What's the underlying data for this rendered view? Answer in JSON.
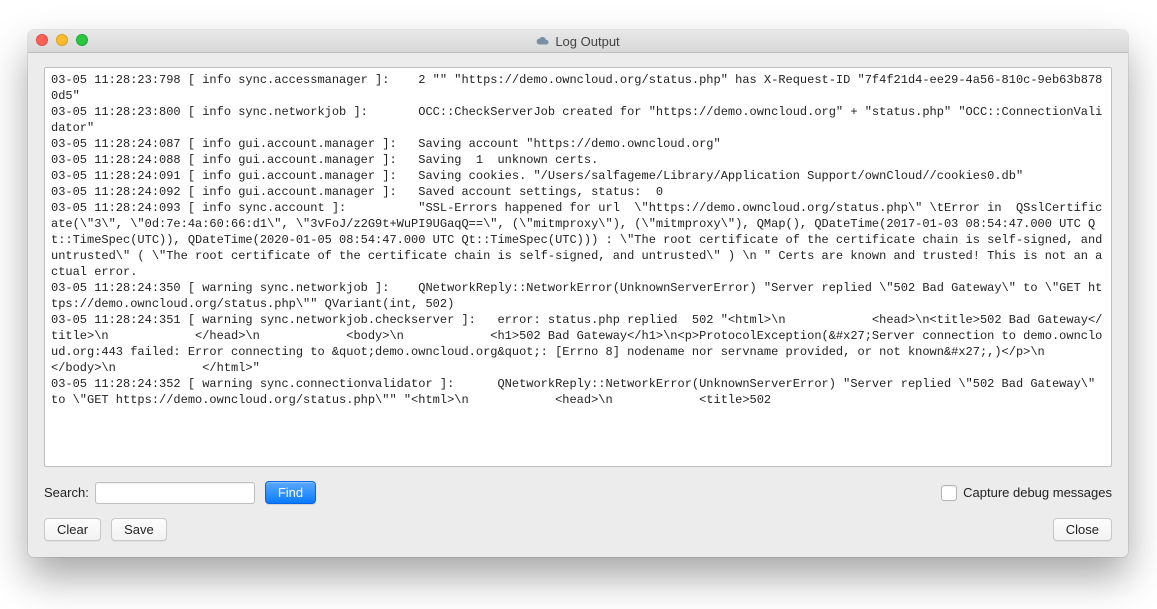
{
  "window": {
    "title": "Log Output"
  },
  "log": {
    "lines": [
      "03-05 11:28:23:798 [ info sync.accessmanager ]:    2 \"\" \"https://demo.owncloud.org/status.php\" has X-Request-ID \"7f4f21d4-ee29-4a56-810c-9eb63b8780d5\"",
      "03-05 11:28:23:800 [ info sync.networkjob ]:       OCC::CheckServerJob created for \"https://demo.owncloud.org\" + \"status.php\" \"OCC::ConnectionValidator\"",
      "03-05 11:28:24:087 [ info gui.account.manager ]:   Saving account \"https://demo.owncloud.org\"",
      "03-05 11:28:24:088 [ info gui.account.manager ]:   Saving  1  unknown certs.",
      "03-05 11:28:24:091 [ info gui.account.manager ]:   Saving cookies. \"/Users/salfageme/Library/Application Support/ownCloud//cookies0.db\"",
      "03-05 11:28:24:092 [ info gui.account.manager ]:   Saved account settings, status:  0",
      "03-05 11:28:24:093 [ info sync.account ]:          \"SSL-Errors happened for url  \\\"https://demo.owncloud.org/status.php\\\" \\tError in  QSslCertificate(\\\"3\\\", \\\"0d:7e:4a:60:66:d1\\\", \\\"3vFoJ/z2G9t+WuPI9UGaqQ==\\\", (\\\"mitmproxy\\\"), (\\\"mitmproxy\\\"), QMap(), QDateTime(2017-01-03 08:54:47.000 UTC Qt::TimeSpec(UTC)), QDateTime(2020-01-05 08:54:47.000 UTC Qt::TimeSpec(UTC))) : \\\"The root certificate of the certificate chain is self-signed, and untrusted\\\" ( \\\"The root certificate of the certificate chain is self-signed, and untrusted\\\" ) \\n \" Certs are known and trusted! This is not an actual error.",
      "03-05 11:28:24:350 [ warning sync.networkjob ]:    QNetworkReply::NetworkError(UnknownServerError) \"Server replied \\\"502 Bad Gateway\\\" to \\\"GET https://demo.owncloud.org/status.php\\\"\" QVariant(int, 502)",
      "03-05 11:28:24:351 [ warning sync.networkjob.checkserver ]:   error: status.php replied  502 \"<html>\\n            <head>\\n<title>502 Bad Gateway</title>\\n            </head>\\n            <body>\\n            <h1>502 Bad Gateway</h1>\\n<p>ProtocolException(&#x27;Server connection to demo.owncloud.org:443 failed: Error connecting to &quot;demo.owncloud.org&quot;: [Errno 8] nodename nor servname provided, or not known&#x27;,)</p>\\n            </body>\\n            </html>\"",
      "03-05 11:28:24:352 [ warning sync.connectionvalidator ]:      QNetworkReply::NetworkError(UnknownServerError) \"Server replied \\\"502 Bad Gateway\\\" to \\\"GET https://demo.owncloud.org/status.php\\\"\" \"<html>\\n            <head>\\n            <title>502"
    ]
  },
  "search": {
    "label": "Search:",
    "value": "",
    "find_label": "Find"
  },
  "capture": {
    "label": "Capture debug messages",
    "checked": false
  },
  "buttons": {
    "clear": "Clear",
    "save": "Save",
    "close": "Close"
  }
}
